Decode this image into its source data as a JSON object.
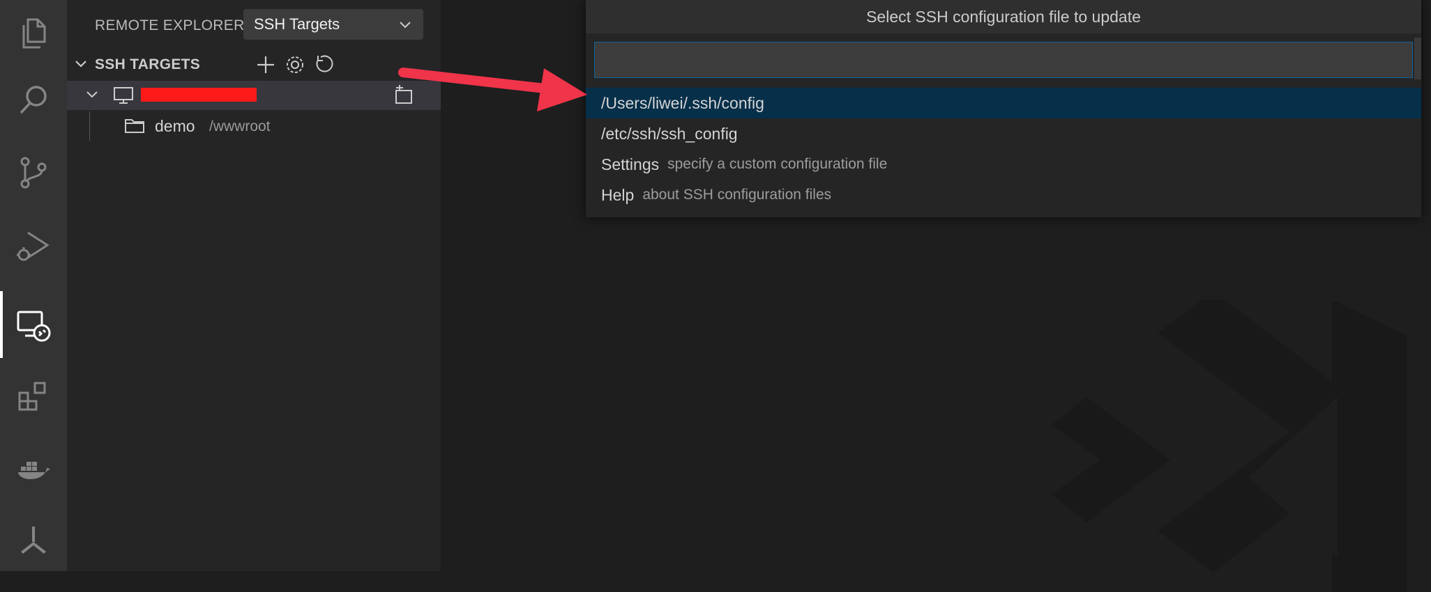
{
  "activity_bar": {
    "items": [
      {
        "icon": "files-icon"
      },
      {
        "icon": "search-icon"
      },
      {
        "icon": "source-control-icon"
      },
      {
        "icon": "run-debug-icon"
      },
      {
        "icon": "remote-explorer-icon",
        "active": true
      },
      {
        "icon": "extensions-icon"
      },
      {
        "icon": "docker-icon"
      },
      {
        "icon": "deploy-icon"
      }
    ]
  },
  "sidebar": {
    "title": "REMOTE EXPLORER",
    "target_select": "SSH Targets",
    "section_title": "SSH TARGETS",
    "section_actions": [
      "add-icon",
      "gear-icon",
      "refresh-icon"
    ],
    "tree": {
      "host": {
        "icon": "monitor-icon",
        "name_redacted": true
      },
      "folder": {
        "name": "demo",
        "path": "/wwwroot"
      }
    }
  },
  "quick_pick": {
    "title": "Select SSH configuration file to update",
    "input_value": "",
    "items": [
      {
        "label": "/Users/liwei/.ssh/config",
        "description": "",
        "selected": true
      },
      {
        "label": "/etc/ssh/ssh_config",
        "description": ""
      },
      {
        "label": "Settings",
        "description": "specify a custom configuration file"
      },
      {
        "label": "Help",
        "description": "about SSH configuration files"
      }
    ]
  },
  "colors": {
    "activity_bar": "#333333",
    "sidebar": "#252526",
    "editor": "#1e1e1e",
    "selected_item": "#062f4a",
    "annotation_arrow": "#f0344a",
    "redaction": "#ff1a1a"
  }
}
